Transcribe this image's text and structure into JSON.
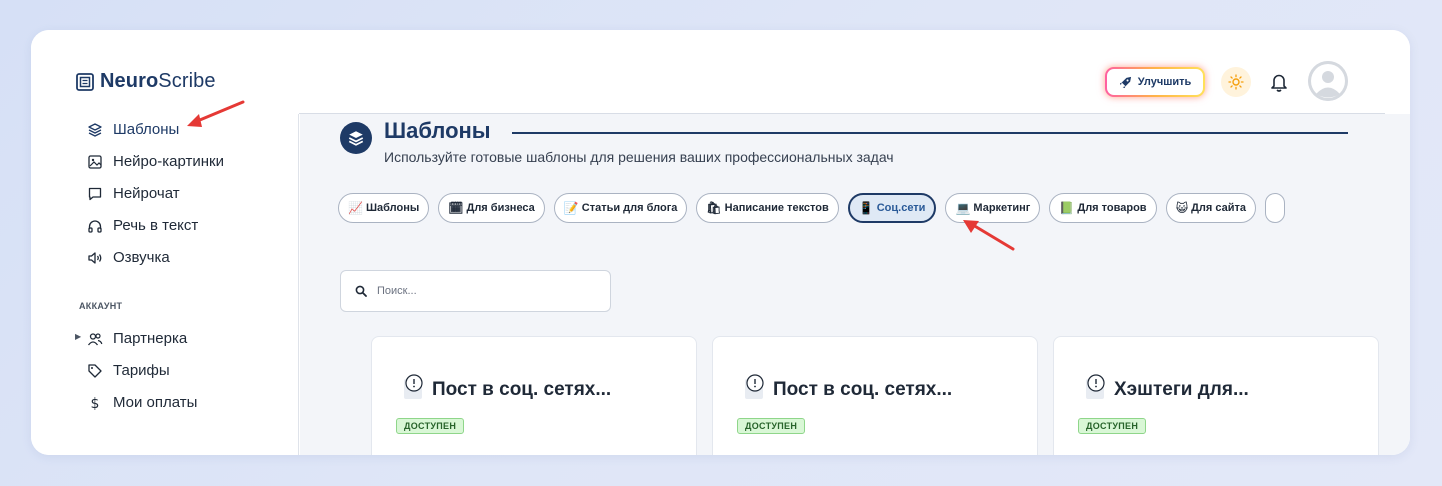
{
  "app": {
    "logo_bold": "Neuro",
    "logo_rest": "Scribe"
  },
  "header": {
    "upgrade_label": "Улучшить"
  },
  "sidebar": {
    "items": [
      {
        "label": "Шаблоны",
        "icon": "layers-icon"
      },
      {
        "label": "Нейро-картинки",
        "icon": "image-icon"
      },
      {
        "label": "Нейрочат",
        "icon": "chat-icon"
      },
      {
        "label": "Речь в текст",
        "icon": "headphones-icon"
      },
      {
        "label": "Озвучка",
        "icon": "speaker-icon"
      }
    ],
    "section_account": "АККАУНТ",
    "account_items": [
      {
        "label": "Партнерка",
        "icon": "users-icon"
      },
      {
        "label": "Тарифы",
        "icon": "tag-icon"
      },
      {
        "label": "Мои оплаты",
        "icon": "dollar-icon"
      }
    ]
  },
  "main": {
    "title": "Шаблоны",
    "subtitle": "Используйте готовые шаблоны для решения ваших профессиональных задач",
    "categories": [
      {
        "emoji": "📈",
        "label": "Шаблоны"
      },
      {
        "emoji": "🗓",
        "label": "Для бизнеса"
      },
      {
        "emoji": "📝",
        "label": "Статьи для блога"
      },
      {
        "emoji": "🛍",
        "label": "Написание текстов"
      },
      {
        "emoji": "📱",
        "label": "Соц.сети"
      },
      {
        "emoji": "💻",
        "label": "Маркетинг"
      },
      {
        "emoji": "📗",
        "label": "Для товаров"
      },
      {
        "emoji": "😺",
        "label": "Для сайта"
      }
    ],
    "active_category": "Соц.сети",
    "search_placeholder": "Поиск...",
    "cards": [
      {
        "title": "Пост в соц. сетях...",
        "badge": "ДОСТУПЕН"
      },
      {
        "title": "Пост в соц. сетях...",
        "badge": "ДОСТУПЕН"
      },
      {
        "title": "Хэштеги для...",
        "badge": "ДОСТУПЕН"
      }
    ]
  },
  "colors": {
    "brand_navy": "#1e3a66",
    "badge_green": "#d9f7d6",
    "annotation_red": "#e53935"
  }
}
